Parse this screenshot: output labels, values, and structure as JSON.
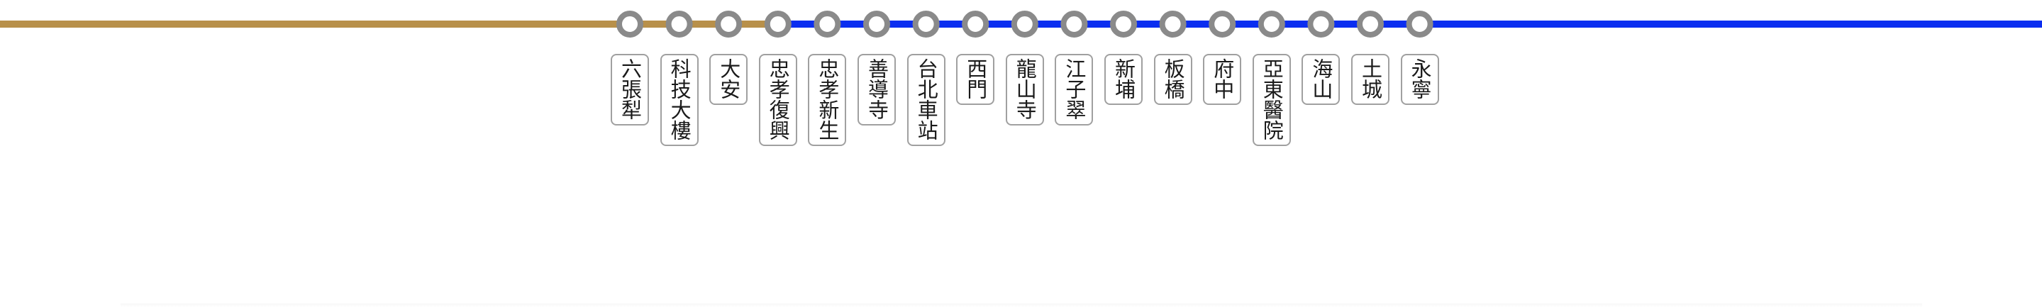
{
  "line_colors": {
    "brown": "#B8904A",
    "blue": "#0B2EF0",
    "station_ring": "#8a8a8a",
    "label_border": "#a0a0a0"
  },
  "stations": [
    {
      "name": "六張犁",
      "segment_before": "brown"
    },
    {
      "name": "科技大樓",
      "segment_before": "brown"
    },
    {
      "name": "大安",
      "segment_before": "brown"
    },
    {
      "name": "忠孝復興",
      "segment_before": "brown"
    },
    {
      "name": "忠孝新生",
      "segment_before": "blue"
    },
    {
      "name": "善導寺",
      "segment_before": "blue"
    },
    {
      "name": "台北車站",
      "segment_before": "blue"
    },
    {
      "name": "西門",
      "segment_before": "blue"
    },
    {
      "name": "龍山寺",
      "segment_before": "blue"
    },
    {
      "name": "江子翠",
      "segment_before": "blue"
    },
    {
      "name": "新埔",
      "segment_before": "blue"
    },
    {
      "name": "板橋",
      "segment_before": "blue"
    },
    {
      "name": "府中",
      "segment_before": "blue"
    },
    {
      "name": "亞東醫院",
      "segment_before": "blue"
    },
    {
      "name": "海山",
      "segment_before": "blue"
    },
    {
      "name": "土城",
      "segment_before": "blue"
    },
    {
      "name": "永寧",
      "segment_before": "blue"
    }
  ]
}
